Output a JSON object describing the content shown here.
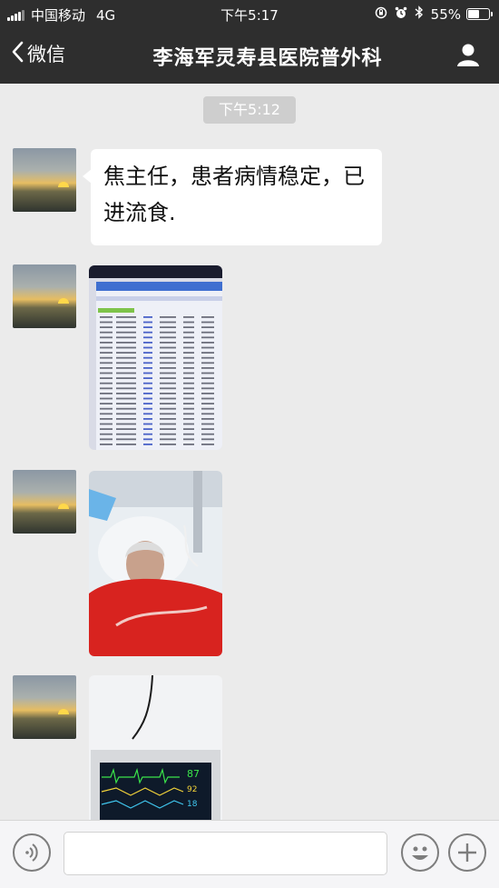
{
  "status_bar": {
    "carrier": "中国移动",
    "network": "4G",
    "time": "下午5:17",
    "battery": "55%",
    "battery_level": 0.55,
    "icons": [
      "signal-icon",
      "lock-rotation-icon",
      "alarm-icon",
      "bluetooth-icon",
      "battery-icon"
    ]
  },
  "nav": {
    "back_label": "微信",
    "title": "李海军灵寿县医院普外科",
    "icons": [
      "chevron-left-icon",
      "profile-icon"
    ]
  },
  "chat": {
    "timestamp": "下午5:12",
    "messages": [
      {
        "type": "text",
        "text": "焦主任，患者病情稳定，已进流食."
      },
      {
        "type": "image",
        "content": "spreadsheet-screenshot"
      },
      {
        "type": "image",
        "content": "patient-in-bed-photo"
      },
      {
        "type": "image",
        "content": "vital-signs-monitor-photo"
      }
    ]
  },
  "input_bar": {
    "icons": [
      "voice-icon",
      "emoji-icon",
      "add-icon"
    ],
    "text_value": ""
  },
  "colors": {
    "header_bg": "#2e2e2e",
    "chat_bg": "#ebebeb",
    "bubble_bg": "#ffffff",
    "timestamp_bg": "#cecece"
  }
}
